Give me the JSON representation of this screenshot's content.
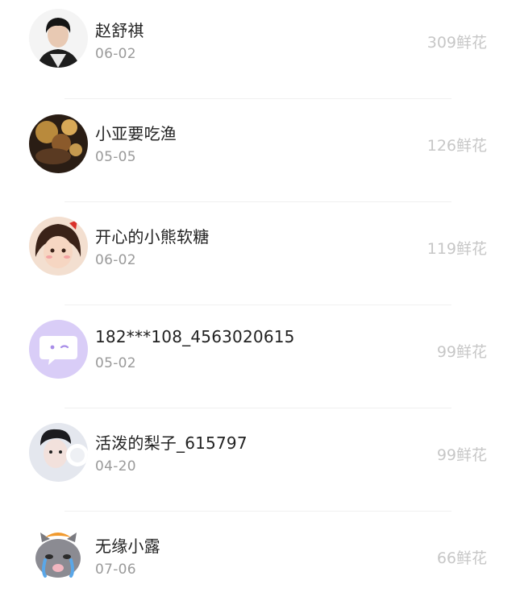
{
  "users": [
    {
      "name": "赵舒祺",
      "date": "06-02",
      "flowers": "309鲜花",
      "avatar_icon": "person-photo-avatar-icon"
    },
    {
      "name": "小亚要吃渔",
      "date": "05-05",
      "flowers": "126鲜花",
      "avatar_icon": "dark-photo-avatar-icon"
    },
    {
      "name": "开心的小熊软糖",
      "date": "06-02",
      "flowers": "119鲜花",
      "avatar_icon": "cartoon-girl-avatar-icon"
    },
    {
      "name": "182***108_4563020615",
      "date": "05-02",
      "flowers": "99鲜花",
      "avatar_icon": "chat-bubble-avatar-icon"
    },
    {
      "name": "活泼的梨子_615797",
      "date": "04-20",
      "flowers": "99鲜花",
      "avatar_icon": "person-headphones-avatar-icon"
    },
    {
      "name": "无缘小露",
      "date": "07-06",
      "flowers": "66鲜花",
      "avatar_icon": "crying-cat-avatar-icon"
    }
  ],
  "colors": {
    "name": "#222222",
    "date": "#9a9a9a",
    "flowers": "#c7c7c7",
    "chat_avatar_bg": "#d9cdf7",
    "chat_avatar_fg": "#a88de8"
  }
}
